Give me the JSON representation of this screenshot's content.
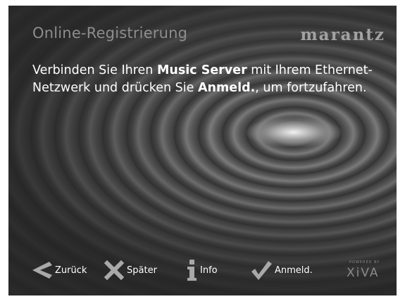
{
  "header": {
    "title": "Online-Registrierung",
    "brand_logo": "marantz"
  },
  "message": {
    "part1": "Verbinden Sie Ihren ",
    "bold1": "Music Server",
    "part2": " mit Ihrem Ethernet-Netzwerk und drücken Sie ",
    "bold2": "Anmeld.",
    "part3": ", um fortzufahren."
  },
  "buttons": {
    "back": {
      "label": "Zurück",
      "icon": "chevron-left-icon"
    },
    "later": {
      "label": "Später",
      "icon": "x-icon"
    },
    "info": {
      "label": "Info",
      "icon": "info-icon"
    },
    "login": {
      "label": "Anmeld.",
      "icon": "checkmark-icon"
    }
  },
  "footer_logo": {
    "powered_by": "POWERED BY",
    "brand": "XiVA"
  },
  "colors": {
    "text": "#ffffff",
    "muted": "#8d8d8d",
    "icon": "#a9a9a9"
  }
}
